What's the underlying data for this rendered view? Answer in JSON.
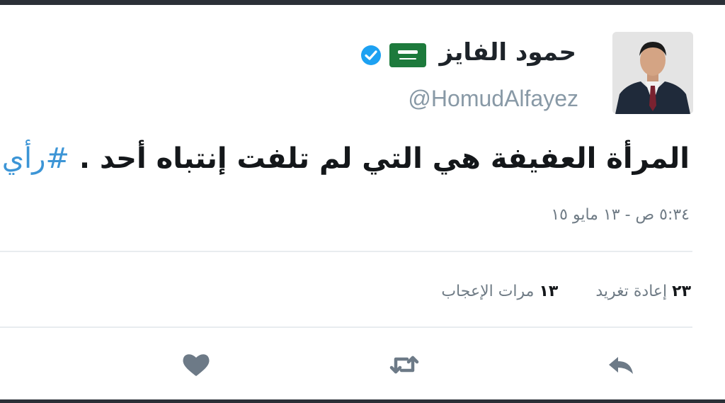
{
  "tweet": {
    "author": {
      "display_name": "حمود الفايز",
      "handle": "@HomudAlfayez",
      "verified": true,
      "flag_icon": "saudi-flag-icon",
      "avatar": "profile-photo"
    },
    "text": {
      "body": "المرأة العفيفة هي التي لم تلفت إنتباه أحد .",
      "hashtag": "#رأي"
    },
    "timestamp": "٥:٣٤ ص - ١٣ مايو ١٥",
    "stats": {
      "retweets_count": "٢٣",
      "retweets_label": "إعادة تغريد",
      "likes_count": "١٣",
      "likes_label": "مرات الإعجاب"
    },
    "actions": [
      "reply-icon",
      "retweet-icon",
      "heart-icon"
    ]
  },
  "colors": {
    "hashtag": "#3c95d6",
    "verified": "#1da1f2",
    "flag": "#1d7a3c",
    "secondary_text": "#8899a6",
    "action_icons": "#6d7a87",
    "frame": "#2b3037"
  }
}
